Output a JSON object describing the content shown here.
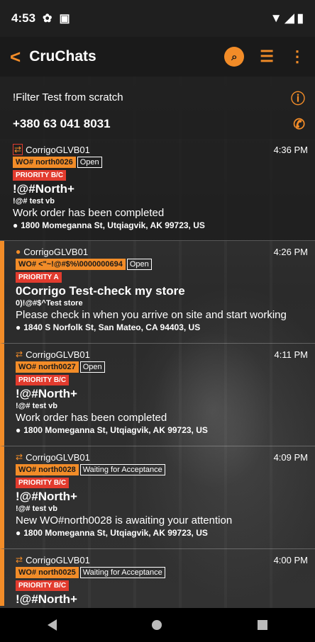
{
  "status_bar": {
    "time": "4:53",
    "icons": [
      "gear-icon",
      "sim-icon"
    ],
    "right_icons": [
      "wifi-icon",
      "signal-icon",
      "battery-icon"
    ]
  },
  "app_bar": {
    "title": "CruChats",
    "back_icon": "chevron-left-icon",
    "actions": [
      "search-icon",
      "filter-icon",
      "more-icon"
    ]
  },
  "info": {
    "filter_title": "!Filter Test from scratch",
    "phone": "+380 63 041 8031"
  },
  "messages": [
    {
      "sender": "CorrigoGLVB01",
      "time": "4:36 PM",
      "wo": "WO# north0026",
      "status": "Open",
      "priority": "PRIORITY B/C",
      "title": "!@#North+",
      "subtitle": "!@# test vb",
      "message": "Work order has been completed",
      "address": "1800 Momeganna St, Utqiagvik, AK 99723, US"
    },
    {
      "sender": "CorrigoGLVB01",
      "time": "4:26 PM",
      "wo": "WO# <\"~!@#$%\\0000000694",
      "status": "Open",
      "priority": "PRIORITY A",
      "title": "0Corrigo Test-check my store",
      "subtitle": "0)!@#$^Test store",
      "message": "Please check in when you arrive on site and start working",
      "address": "1840 S Norfolk St, San Mateo, CA 94403, US"
    },
    {
      "sender": "CorrigoGLVB01",
      "time": "4:11 PM",
      "wo": "WO# north0027",
      "status": "Open",
      "priority": "PRIORITY B/C",
      "title": "!@#North+",
      "subtitle": "!@# test vb",
      "message": "Work order has been completed",
      "address": "1800 Momeganna St, Utqiagvik, AK 99723, US"
    },
    {
      "sender": "CorrigoGLVB01",
      "time": "4:09 PM",
      "wo": "WO# north0028",
      "status": "Waiting for Acceptance",
      "priority": "PRIORITY B/C",
      "title": "!@#North+",
      "subtitle": "!@# test vb",
      "message": "New WO#north0028 is awaiting your attention",
      "address": "1800 Momeganna St, Utqiagvik, AK 99723, US"
    },
    {
      "sender": "CorrigoGLVB01",
      "time": "4:00 PM",
      "wo": "WO# north0025",
      "status": "Waiting for Acceptance",
      "priority": "PRIORITY B/C",
      "title": "!@#North+",
      "subtitle": "",
      "message": "",
      "address": ""
    }
  ],
  "colors": {
    "accent": "#f28c28",
    "priority": "#e23b2e"
  }
}
